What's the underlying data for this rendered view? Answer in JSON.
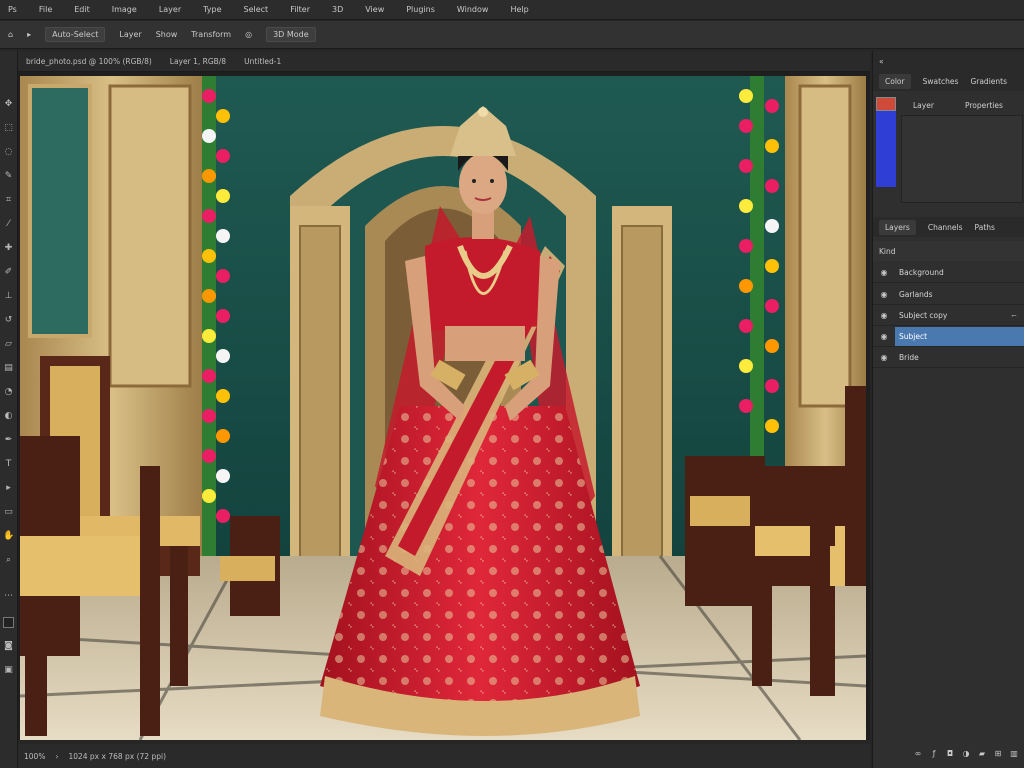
{
  "menubar": {
    "items": [
      "Ps",
      "File",
      "Edit",
      "Image",
      "Layer",
      "Type",
      "Select",
      "Filter",
      "3D",
      "View",
      "Plugins",
      "Window",
      "Help"
    ]
  },
  "options": {
    "items": [
      "⌂",
      "▸",
      "Auto-Select",
      "Layer",
      "Show",
      "Transform",
      "◎",
      "3D Mode"
    ]
  },
  "document": {
    "tab_label": "bride_photo.psd @ 100% (RGB/8)",
    "tab_extra": "Layer 1, RGB/8",
    "tab_extra2": "Untitled-1"
  },
  "status": {
    "zoom": "100%",
    "doc_size": "1024 px x 768 px (72 ppi)",
    "arrow": "›"
  },
  "panels": {
    "top_tabs": [
      "Color",
      "Swatches",
      "Gradients"
    ],
    "properties_title": "Layer",
    "properties_extra": "Properties",
    "layers_tabs": [
      "Layers",
      "Channels",
      "Paths"
    ],
    "layers_header": "Kind",
    "layers": [
      {
        "name": "Background",
        "selected": false
      },
      {
        "name": "Garlands",
        "selected": false
      },
      {
        "name": "Subject copy",
        "selected": false
      },
      {
        "name": "Subject",
        "selected": true
      },
      {
        "name": "Bride",
        "selected": false
      }
    ],
    "footer_icons": [
      "link-icon",
      "fx-icon",
      "mask-icon",
      "adjustment-icon",
      "folder-icon",
      "new-layer-icon",
      "trash-icon"
    ]
  },
  "colors": {
    "accent": "#4a79b0",
    "fg_swatch": "#2f3fd6",
    "bg_swatch": "#d04a3a"
  }
}
